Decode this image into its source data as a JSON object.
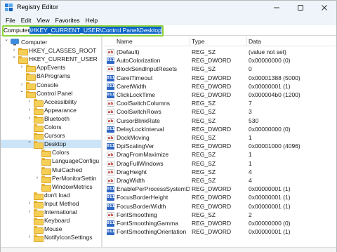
{
  "window": {
    "title": "Registry Editor",
    "icon": "registry-editor-icon"
  },
  "menu": [
    "File",
    "Edit",
    "View",
    "Favorites",
    "Help"
  ],
  "address": {
    "prefix": "Computer",
    "selected": "\\HKEY_CURRENT_USER\\Control Panel\\Desktop",
    "highlight_color": "#8bd43a"
  },
  "tree": [
    {
      "label": "Computer",
      "depth": 0,
      "toggle": "down",
      "icon": "computer-icon"
    },
    {
      "label": "HKEY_CLASSES_ROOT",
      "depth": 1,
      "toggle": "right",
      "icon": "folder-icon"
    },
    {
      "label": "HKEY_CURRENT_USER",
      "depth": 1,
      "toggle": "down",
      "icon": "folder-icon"
    },
    {
      "label": "AppEvents",
      "depth": 2,
      "toggle": "right",
      "icon": "folder-icon"
    },
    {
      "label": "BAPrograms",
      "depth": 2,
      "toggle": "",
      "icon": "folder-icon"
    },
    {
      "label": "Console",
      "depth": 2,
      "toggle": "right",
      "icon": "folder-icon"
    },
    {
      "label": "Control Panel",
      "depth": 2,
      "toggle": "down",
      "icon": "folder-icon"
    },
    {
      "label": "Accessibility",
      "depth": 3,
      "toggle": "right",
      "icon": "folder-icon"
    },
    {
      "label": "Appearance",
      "depth": 3,
      "toggle": "right",
      "icon": "folder-icon"
    },
    {
      "label": "Bluetooth",
      "depth": 3,
      "toggle": "right",
      "icon": "folder-icon"
    },
    {
      "label": "Colors",
      "depth": 3,
      "toggle": "",
      "icon": "folder-icon"
    },
    {
      "label": "Cursors",
      "depth": 3,
      "toggle": "",
      "icon": "folder-icon"
    },
    {
      "label": "Desktop",
      "depth": 3,
      "toggle": "down",
      "icon": "folder-icon",
      "selected": true
    },
    {
      "label": "Colors",
      "depth": 4,
      "toggle": "",
      "icon": "folder-icon"
    },
    {
      "label": "LanguageConfigu",
      "depth": 4,
      "toggle": "",
      "icon": "folder-icon"
    },
    {
      "label": "MuiCached",
      "depth": 4,
      "toggle": "",
      "icon": "folder-icon"
    },
    {
      "label": "PerMonitorSettin",
      "depth": 4,
      "toggle": "right",
      "icon": "folder-icon"
    },
    {
      "label": "WindowMetrics",
      "depth": 4,
      "toggle": "",
      "icon": "folder-icon"
    },
    {
      "label": "don't load",
      "depth": 3,
      "toggle": "",
      "icon": "folder-icon"
    },
    {
      "label": "Input Method",
      "depth": 3,
      "toggle": "right",
      "icon": "folder-icon"
    },
    {
      "label": "International",
      "depth": 3,
      "toggle": "right",
      "icon": "folder-icon"
    },
    {
      "label": "Keyboard",
      "depth": 3,
      "toggle": "",
      "icon": "folder-icon"
    },
    {
      "label": "Mouse",
      "depth": 3,
      "toggle": "",
      "icon": "folder-icon"
    },
    {
      "label": "NotifyIconSettings",
      "depth": 3,
      "toggle": "right",
      "icon": "folder-icon"
    }
  ],
  "list": {
    "headers": {
      "name": "Name",
      "type": "Type",
      "data": "Data"
    },
    "rows": [
      {
        "name": "(Default)",
        "type": "REG_SZ",
        "data": "(value not set)",
        "kind": "sz"
      },
      {
        "name": "AutoColorization",
        "type": "REG_DWORD",
        "data": "0x00000000 (0)",
        "kind": "dword"
      },
      {
        "name": "BlockSendInputResets",
        "type": "REG_SZ",
        "data": "0",
        "kind": "sz"
      },
      {
        "name": "CaretTimeout",
        "type": "REG_DWORD",
        "data": "0x00001388 (5000)",
        "kind": "dword"
      },
      {
        "name": "CaretWidth",
        "type": "REG_DWORD",
        "data": "0x00000001 (1)",
        "kind": "dword"
      },
      {
        "name": "ClickLockTime",
        "type": "REG_DWORD",
        "data": "0x000004b0 (1200)",
        "kind": "dword"
      },
      {
        "name": "CoolSwitchColumns",
        "type": "REG_SZ",
        "data": "7",
        "kind": "sz"
      },
      {
        "name": "CoolSwitchRows",
        "type": "REG_SZ",
        "data": "3",
        "kind": "sz"
      },
      {
        "name": "CursorBlinkRate",
        "type": "REG_SZ",
        "data": "530",
        "kind": "sz"
      },
      {
        "name": "DelayLockInterval",
        "type": "REG_DWORD",
        "data": "0x00000000 (0)",
        "kind": "dword"
      },
      {
        "name": "DockMoving",
        "type": "REG_SZ",
        "data": "1",
        "kind": "sz"
      },
      {
        "name": "DpiScalingVer",
        "type": "REG_DWORD",
        "data": "0x00001000 (4096)",
        "kind": "dword"
      },
      {
        "name": "DragFromMaximize",
        "type": "REG_SZ",
        "data": "1",
        "kind": "sz"
      },
      {
        "name": "DragFullWindows",
        "type": "REG_SZ",
        "data": "1",
        "kind": "sz"
      },
      {
        "name": "DragHeight",
        "type": "REG_SZ",
        "data": "4",
        "kind": "sz"
      },
      {
        "name": "DragWidth",
        "type": "REG_SZ",
        "data": "4",
        "kind": "sz"
      },
      {
        "name": "EnablePerProcessSystemDPI",
        "type": "REG_DWORD",
        "data": "0x00000001 (1)",
        "kind": "dword"
      },
      {
        "name": "FocusBorderHeight",
        "type": "REG_DWORD",
        "data": "0x00000001 (1)",
        "kind": "dword"
      },
      {
        "name": "FocusBorderWidth",
        "type": "REG_DWORD",
        "data": "0x00000001 (1)",
        "kind": "dword"
      },
      {
        "name": "FontSmoothing",
        "type": "REG_SZ",
        "data": "2",
        "kind": "sz"
      },
      {
        "name": "FontSmoothingGamma",
        "type": "REG_DWORD",
        "data": "0x00000000 (0)",
        "kind": "dword"
      },
      {
        "name": "FontSmoothingOrientation",
        "type": "REG_DWORD",
        "data": "0x00000001 (1)",
        "kind": "dword"
      }
    ]
  }
}
